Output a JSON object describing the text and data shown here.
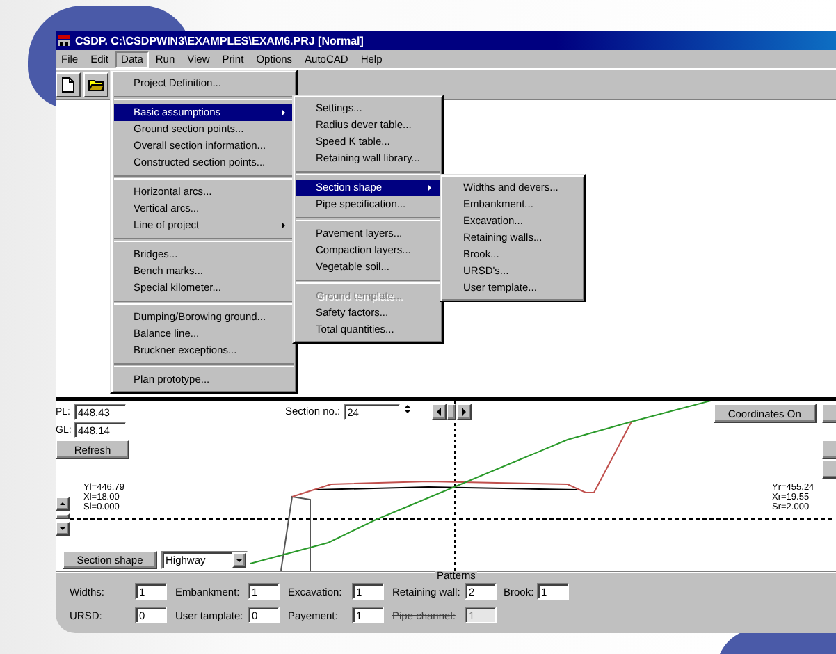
{
  "window": {
    "title": "CSDP. C:\\CSDPWIN3\\EXAMPLES\\EXAM6.PRJ [Normal]"
  },
  "menu_bar": [
    {
      "label": "File",
      "selected": false
    },
    {
      "label": "Edit",
      "selected": false
    },
    {
      "label": "Data",
      "selected": true
    },
    {
      "label": "Run",
      "selected": false
    },
    {
      "label": "View",
      "selected": false
    },
    {
      "label": "Print",
      "selected": false
    },
    {
      "label": "Options",
      "selected": false
    },
    {
      "label": "AutoCAD",
      "selected": false
    },
    {
      "label": "Help",
      "selected": false
    }
  ],
  "menus": [
    {
      "items": [
        {
          "kind": "item",
          "label": "Project Definition...",
          "selected": false,
          "disabled": false,
          "has_submenu": false
        },
        {
          "kind": "separator"
        },
        {
          "kind": "item",
          "label": "Basic assumptions",
          "selected": true,
          "disabled": false,
          "has_submenu": true
        },
        {
          "kind": "item",
          "label": "Ground section points...",
          "selected": false,
          "disabled": false,
          "has_submenu": false
        },
        {
          "kind": "item",
          "label": "Overall section information...",
          "selected": false,
          "disabled": false,
          "has_submenu": false
        },
        {
          "kind": "item",
          "label": "Constructed section points...",
          "selected": false,
          "disabled": false,
          "has_submenu": false
        },
        {
          "kind": "separator"
        },
        {
          "kind": "item",
          "label": "Horizontal arcs...",
          "selected": false,
          "disabled": false,
          "has_submenu": false
        },
        {
          "kind": "item",
          "label": "Vertical arcs...",
          "selected": false,
          "disabled": false,
          "has_submenu": false
        },
        {
          "kind": "item",
          "label": "Line of project",
          "selected": false,
          "disabled": false,
          "has_submenu": true
        },
        {
          "kind": "separator"
        },
        {
          "kind": "item",
          "label": "Bridges...",
          "selected": false,
          "disabled": false,
          "has_submenu": false
        },
        {
          "kind": "item",
          "label": "Bench marks...",
          "selected": false,
          "disabled": false,
          "has_submenu": false
        },
        {
          "kind": "item",
          "label": "Special kilometer...",
          "selected": false,
          "disabled": false,
          "has_submenu": false
        },
        {
          "kind": "separator"
        },
        {
          "kind": "item",
          "label": "Dumping/Borowing ground...",
          "selected": false,
          "disabled": false,
          "has_submenu": false
        },
        {
          "kind": "item",
          "label": "Balance line...",
          "selected": false,
          "disabled": false,
          "has_submenu": false
        },
        {
          "kind": "item",
          "label": "Bruckner exceptions...",
          "selected": false,
          "disabled": false,
          "has_submenu": false
        },
        {
          "kind": "separator"
        },
        {
          "kind": "item",
          "label": "Plan prototype...",
          "selected": false,
          "disabled": false,
          "has_submenu": false
        }
      ]
    },
    {
      "items": [
        {
          "kind": "item",
          "label": "Settings...",
          "selected": false,
          "disabled": false,
          "has_submenu": false
        },
        {
          "kind": "item",
          "label": "Radius dever table...",
          "selected": false,
          "disabled": false,
          "has_submenu": false
        },
        {
          "kind": "item",
          "label": "Speed K table...",
          "selected": false,
          "disabled": false,
          "has_submenu": false
        },
        {
          "kind": "item",
          "label": "Retaining wall library...",
          "selected": false,
          "disabled": false,
          "has_submenu": false
        },
        {
          "kind": "separator"
        },
        {
          "kind": "item",
          "label": "Section shape",
          "selected": true,
          "disabled": false,
          "has_submenu": true
        },
        {
          "kind": "item",
          "label": "Pipe specification...",
          "selected": false,
          "disabled": false,
          "has_submenu": false
        },
        {
          "kind": "separator"
        },
        {
          "kind": "item",
          "label": "Pavement layers...",
          "selected": false,
          "disabled": false,
          "has_submenu": false
        },
        {
          "kind": "item",
          "label": "Compaction layers...",
          "selected": false,
          "disabled": false,
          "has_submenu": false
        },
        {
          "kind": "item",
          "label": "Vegetable soil...",
          "selected": false,
          "disabled": false,
          "has_submenu": false
        },
        {
          "kind": "separator"
        },
        {
          "kind": "item",
          "label": "Ground template...",
          "selected": false,
          "disabled": true,
          "has_submenu": false
        },
        {
          "kind": "item",
          "label": "Safety factors...",
          "selected": false,
          "disabled": false,
          "has_submenu": false
        },
        {
          "kind": "item",
          "label": "Total quantities...",
          "selected": false,
          "disabled": false,
          "has_submenu": false
        }
      ]
    },
    {
      "items": [
        {
          "kind": "item",
          "label": "Widths and devers...",
          "selected": false,
          "disabled": false,
          "has_submenu": false
        },
        {
          "kind": "item",
          "label": "Embankment...",
          "selected": false,
          "disabled": false,
          "has_submenu": false
        },
        {
          "kind": "item",
          "label": "Excavation...",
          "selected": false,
          "disabled": false,
          "has_submenu": false
        },
        {
          "kind": "item",
          "label": "Retaining walls...",
          "selected": false,
          "disabled": false,
          "has_submenu": false
        },
        {
          "kind": "item",
          "label": "Brook...",
          "selected": false,
          "disabled": false,
          "has_submenu": false
        },
        {
          "kind": "item",
          "label": "URSD's...",
          "selected": false,
          "disabled": false,
          "has_submenu": false
        },
        {
          "kind": "item",
          "label": "User template...",
          "selected": false,
          "disabled": false,
          "has_submenu": false
        }
      ]
    }
  ],
  "section_view": {
    "pl": {
      "label": "PL:",
      "value": "448.43"
    },
    "gl": {
      "label": "GL:",
      "value": "448.14"
    },
    "refresh_button": "Refresh",
    "section_no": {
      "label": "Section no.:",
      "value": "24"
    },
    "coordinates_button": "Coordinates On",
    "left_readings": [
      "Yl=446.79",
      "Xl=18.00",
      "Sl=0.000"
    ],
    "right_readings": [
      "Yr=455.24",
      "Xr=19.55",
      "Sr=2.000"
    ],
    "section_shape_button": "Section shape",
    "shape_combo": "Highway"
  },
  "patterns": {
    "title": "Patterns",
    "fields": [
      {
        "label": "Widths:",
        "value": "1",
        "disabled": false
      },
      {
        "label": "Embankment:",
        "value": "1",
        "disabled": false
      },
      {
        "label": "Excavation:",
        "value": "1",
        "disabled": false
      },
      {
        "label": "Retaining wall:",
        "value": "2",
        "disabled": false
      },
      {
        "label": "Brook:",
        "value": "1",
        "disabled": false
      },
      {
        "label": "URSD:",
        "value": "0",
        "disabled": false
      },
      {
        "label": "User tamplate:",
        "value": "0",
        "disabled": false
      },
      {
        "label": "Payement:",
        "value": "1",
        "disabled": false
      },
      {
        "label": "Pipe channel:",
        "value": "1",
        "disabled": true
      }
    ]
  }
}
